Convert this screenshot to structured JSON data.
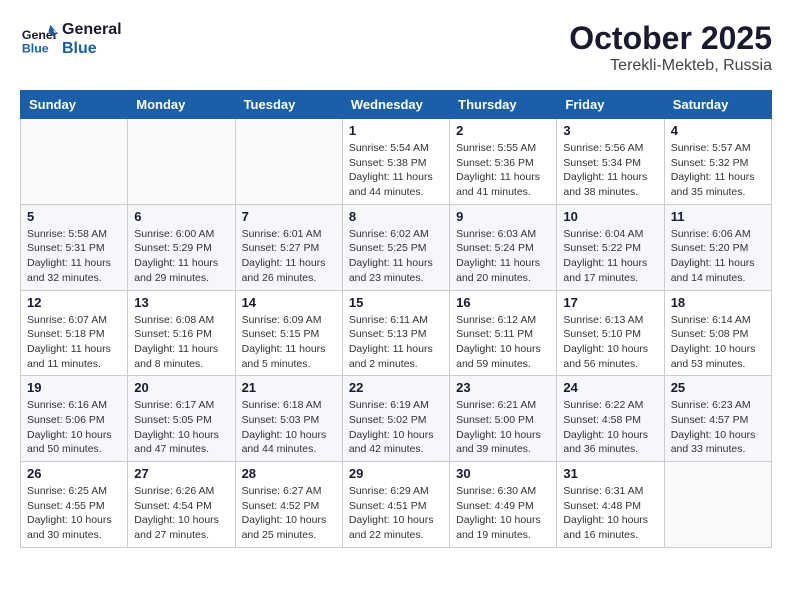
{
  "header": {
    "logo_line1": "General",
    "logo_line2": "Blue",
    "month_year": "October 2025",
    "location": "Terekli-Mekteb, Russia"
  },
  "weekdays": [
    "Sunday",
    "Monday",
    "Tuesday",
    "Wednesday",
    "Thursday",
    "Friday",
    "Saturday"
  ],
  "weeks": [
    [
      {
        "day": "",
        "info": ""
      },
      {
        "day": "",
        "info": ""
      },
      {
        "day": "",
        "info": ""
      },
      {
        "day": "1",
        "info": "Sunrise: 5:54 AM\nSunset: 5:38 PM\nDaylight: 11 hours\nand 44 minutes."
      },
      {
        "day": "2",
        "info": "Sunrise: 5:55 AM\nSunset: 5:36 PM\nDaylight: 11 hours\nand 41 minutes."
      },
      {
        "day": "3",
        "info": "Sunrise: 5:56 AM\nSunset: 5:34 PM\nDaylight: 11 hours\nand 38 minutes."
      },
      {
        "day": "4",
        "info": "Sunrise: 5:57 AM\nSunset: 5:32 PM\nDaylight: 11 hours\nand 35 minutes."
      }
    ],
    [
      {
        "day": "5",
        "info": "Sunrise: 5:58 AM\nSunset: 5:31 PM\nDaylight: 11 hours\nand 32 minutes."
      },
      {
        "day": "6",
        "info": "Sunrise: 6:00 AM\nSunset: 5:29 PM\nDaylight: 11 hours\nand 29 minutes."
      },
      {
        "day": "7",
        "info": "Sunrise: 6:01 AM\nSunset: 5:27 PM\nDaylight: 11 hours\nand 26 minutes."
      },
      {
        "day": "8",
        "info": "Sunrise: 6:02 AM\nSunset: 5:25 PM\nDaylight: 11 hours\nand 23 minutes."
      },
      {
        "day": "9",
        "info": "Sunrise: 6:03 AM\nSunset: 5:24 PM\nDaylight: 11 hours\nand 20 minutes."
      },
      {
        "day": "10",
        "info": "Sunrise: 6:04 AM\nSunset: 5:22 PM\nDaylight: 11 hours\nand 17 minutes."
      },
      {
        "day": "11",
        "info": "Sunrise: 6:06 AM\nSunset: 5:20 PM\nDaylight: 11 hours\nand 14 minutes."
      }
    ],
    [
      {
        "day": "12",
        "info": "Sunrise: 6:07 AM\nSunset: 5:18 PM\nDaylight: 11 hours\nand 11 minutes."
      },
      {
        "day": "13",
        "info": "Sunrise: 6:08 AM\nSunset: 5:16 PM\nDaylight: 11 hours\nand 8 minutes."
      },
      {
        "day": "14",
        "info": "Sunrise: 6:09 AM\nSunset: 5:15 PM\nDaylight: 11 hours\nand 5 minutes."
      },
      {
        "day": "15",
        "info": "Sunrise: 6:11 AM\nSunset: 5:13 PM\nDaylight: 11 hours\nand 2 minutes."
      },
      {
        "day": "16",
        "info": "Sunrise: 6:12 AM\nSunset: 5:11 PM\nDaylight: 10 hours\nand 59 minutes."
      },
      {
        "day": "17",
        "info": "Sunrise: 6:13 AM\nSunset: 5:10 PM\nDaylight: 10 hours\nand 56 minutes."
      },
      {
        "day": "18",
        "info": "Sunrise: 6:14 AM\nSunset: 5:08 PM\nDaylight: 10 hours\nand 53 minutes."
      }
    ],
    [
      {
        "day": "19",
        "info": "Sunrise: 6:16 AM\nSunset: 5:06 PM\nDaylight: 10 hours\nand 50 minutes."
      },
      {
        "day": "20",
        "info": "Sunrise: 6:17 AM\nSunset: 5:05 PM\nDaylight: 10 hours\nand 47 minutes."
      },
      {
        "day": "21",
        "info": "Sunrise: 6:18 AM\nSunset: 5:03 PM\nDaylight: 10 hours\nand 44 minutes."
      },
      {
        "day": "22",
        "info": "Sunrise: 6:19 AM\nSunset: 5:02 PM\nDaylight: 10 hours\nand 42 minutes."
      },
      {
        "day": "23",
        "info": "Sunrise: 6:21 AM\nSunset: 5:00 PM\nDaylight: 10 hours\nand 39 minutes."
      },
      {
        "day": "24",
        "info": "Sunrise: 6:22 AM\nSunset: 4:58 PM\nDaylight: 10 hours\nand 36 minutes."
      },
      {
        "day": "25",
        "info": "Sunrise: 6:23 AM\nSunset: 4:57 PM\nDaylight: 10 hours\nand 33 minutes."
      }
    ],
    [
      {
        "day": "26",
        "info": "Sunrise: 6:25 AM\nSunset: 4:55 PM\nDaylight: 10 hours\nand 30 minutes."
      },
      {
        "day": "27",
        "info": "Sunrise: 6:26 AM\nSunset: 4:54 PM\nDaylight: 10 hours\nand 27 minutes."
      },
      {
        "day": "28",
        "info": "Sunrise: 6:27 AM\nSunset: 4:52 PM\nDaylight: 10 hours\nand 25 minutes."
      },
      {
        "day": "29",
        "info": "Sunrise: 6:29 AM\nSunset: 4:51 PM\nDaylight: 10 hours\nand 22 minutes."
      },
      {
        "day": "30",
        "info": "Sunrise: 6:30 AM\nSunset: 4:49 PM\nDaylight: 10 hours\nand 19 minutes."
      },
      {
        "day": "31",
        "info": "Sunrise: 6:31 AM\nSunset: 4:48 PM\nDaylight: 10 hours\nand 16 minutes."
      },
      {
        "day": "",
        "info": ""
      }
    ]
  ]
}
